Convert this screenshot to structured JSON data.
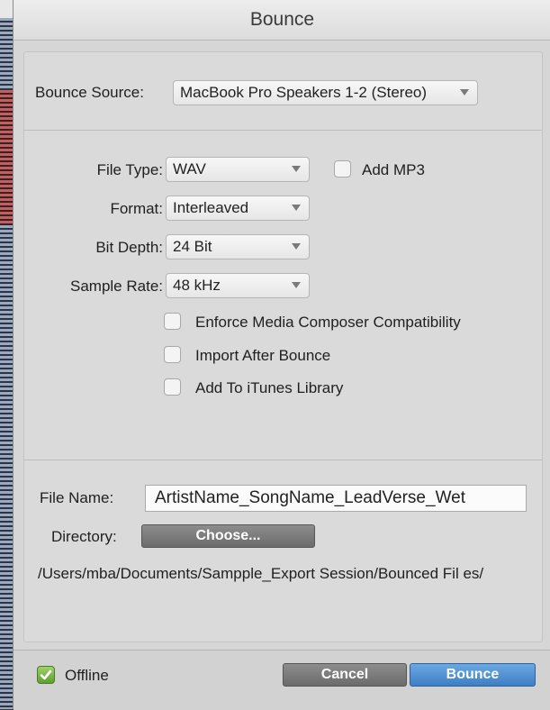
{
  "window": {
    "title": "Bounce"
  },
  "bounce_source": {
    "label": "Bounce Source:",
    "value": "MacBook Pro Speakers 1-2 (Stereo)"
  },
  "file_type": {
    "label": "File Type:",
    "value": "WAV"
  },
  "add_mp3": {
    "label": "Add MP3",
    "checked": false
  },
  "format": {
    "label": "Format:",
    "value": "Interleaved"
  },
  "bit_depth": {
    "label": "Bit Depth:",
    "value": "24 Bit"
  },
  "sample_rate": {
    "label": "Sample Rate:",
    "value": "48 kHz"
  },
  "options": [
    {
      "label": "Enforce Media Composer Compatibility",
      "checked": false
    },
    {
      "label": "Import After Bounce",
      "checked": false
    },
    {
      "label": "Add To iTunes Library",
      "checked": false
    }
  ],
  "file_name": {
    "label": "File Name:",
    "value": "ArtistName_SongName_LeadVerse_Wet"
  },
  "directory": {
    "label": "Directory:",
    "button_label": "Choose...",
    "path": "/Users/mba/Documents/Sampple_Export Session/Bounced Fil es/"
  },
  "footer": {
    "offline_label": "Offline",
    "offline_checked": true,
    "cancel_label": "Cancel",
    "bounce_label": "Bounce"
  },
  "colors": {
    "accent": "#4a8ad0",
    "check_green": "#7ab648"
  }
}
